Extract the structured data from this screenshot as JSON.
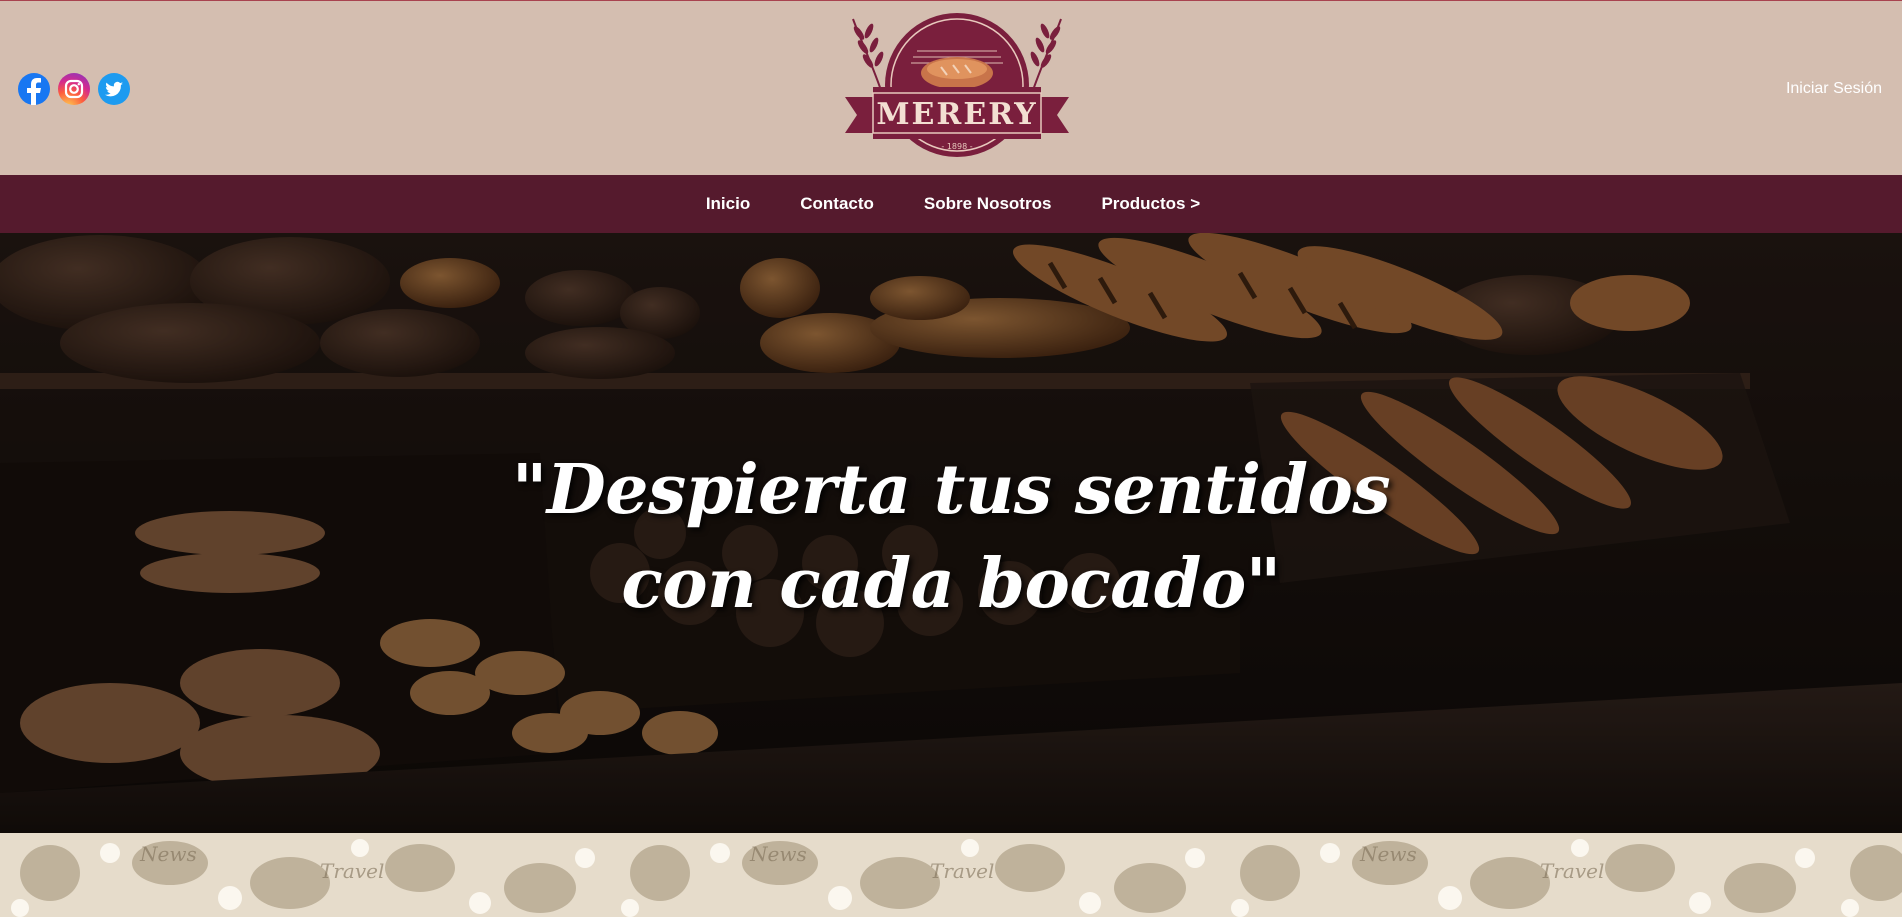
{
  "socials": {
    "facebook_icon": "facebook-icon",
    "instagram_icon": "instagram-icon",
    "twitter_icon": "twitter-icon"
  },
  "logo": {
    "brand": "MERERY",
    "year": "- 1898 -"
  },
  "header": {
    "login_label": "Iniciar Sesión"
  },
  "nav": {
    "items": [
      {
        "label": "Inicio"
      },
      {
        "label": "Contacto"
      },
      {
        "label": "Sobre Nosotros"
      },
      {
        "label": "Productos >"
      }
    ]
  },
  "hero": {
    "line1": "\"Despierta tus sentidos",
    "line2": "con cada bocado\""
  },
  "colors": {
    "header_bg": "#d4beb0",
    "nav_bg": "#551a2d",
    "logo_wine": "#7a1f3d"
  }
}
